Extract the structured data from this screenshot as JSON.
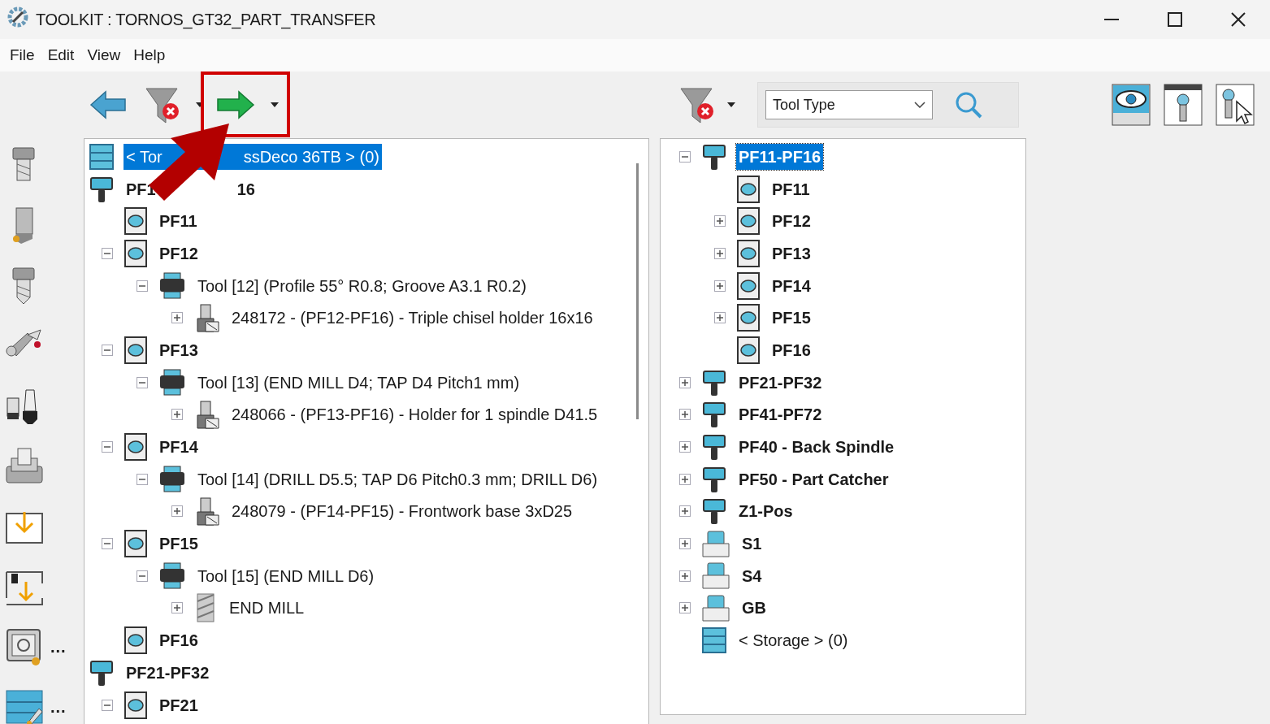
{
  "window": {
    "title": "TOOLKIT : TORNOS_GT32_PART_TRANSFER"
  },
  "menu": [
    "File",
    "Edit",
    "View",
    "Help"
  ],
  "search": {
    "value": "Tool Type"
  },
  "side_tools": [
    {
      "kind": "screw"
    },
    {
      "kind": "insert"
    },
    {
      "kind": "drill"
    },
    {
      "kind": "clamp"
    },
    {
      "kind": "collet"
    },
    {
      "kind": "machine"
    },
    {
      "kind": "import"
    },
    {
      "kind": "tool-import"
    },
    {
      "kind": "safe",
      "more": "..."
    },
    {
      "kind": "storage-edit",
      "more": "..."
    }
  ],
  "left_tree": [
    {
      "kind": "storage",
      "label_parts": [
        "< Tor",
        "ssDeco 36TB > (0)"
      ],
      "expandable": false,
      "selected": true
    },
    {
      "kind": "group",
      "label_parts": [
        "PF1",
        "16"
      ],
      "expandable": false,
      "selected": false,
      "children": [
        {
          "kind": "station",
          "label": "PF11",
          "expandable": false,
          "selected": false
        },
        {
          "kind": "station",
          "label": "PF12",
          "expandable": true,
          "expanded": true,
          "selected": false,
          "children": [
            {
              "kind": "tool",
              "label": "Tool [12] (Profile 55° R0.8; Groove A3.1 R0.2)",
              "expandable": true,
              "expanded": true,
              "selected": false,
              "children": [
                {
                  "kind": "holder",
                  "label": "248172 - (PF12-PF16) - Triple chisel holder 16x16",
                  "expandable": true,
                  "expanded": false,
                  "selected": false
                }
              ]
            }
          ]
        },
        {
          "kind": "station",
          "label": "PF13",
          "expandable": true,
          "expanded": true,
          "selected": false,
          "children": [
            {
              "kind": "tool",
              "label": "Tool [13] (END MILL D4; TAP D4 Pitch1 mm)",
              "expandable": true,
              "expanded": true,
              "selected": false,
              "children": [
                {
                  "kind": "holder",
                  "label": "248066 - (PF13-PF16) - Holder for 1 spindle D41.5",
                  "expandable": true,
                  "expanded": false,
                  "selected": false
                }
              ]
            }
          ]
        },
        {
          "kind": "station",
          "label": "PF14",
          "expandable": true,
          "expanded": true,
          "selected": false,
          "children": [
            {
              "kind": "tool",
              "label": "Tool [14] (DRILL D5.5; TAP D6 Pitch0.3 mm; DRILL D6)",
              "expandable": true,
              "expanded": true,
              "selected": false,
              "children": [
                {
                  "kind": "holder",
                  "label": "248079 - (PF14-PF15) - Frontwork base 3xD25",
                  "expandable": true,
                  "expanded": false,
                  "selected": false
                }
              ]
            }
          ]
        },
        {
          "kind": "station",
          "label": "PF15",
          "expandable": true,
          "expanded": true,
          "selected": false,
          "children": [
            {
              "kind": "tool",
              "label": "Tool [15] (END MILL D6)",
              "expandable": true,
              "expanded": true,
              "selected": false,
              "children": [
                {
                  "kind": "endmill",
                  "label": "END MILL",
                  "expandable": true,
                  "expanded": false,
                  "selected": false
                }
              ]
            }
          ]
        },
        {
          "kind": "station",
          "label": "PF16",
          "expandable": false,
          "selected": false
        }
      ]
    },
    {
      "kind": "group",
      "label": "PF21-PF32",
      "expandable": false,
      "selected": false,
      "children": [
        {
          "kind": "station",
          "label": "PF21",
          "expandable": true,
          "expanded": true,
          "selected": false
        }
      ]
    }
  ],
  "right_tree": [
    {
      "kind": "group",
      "label": "PF11-PF16",
      "expandable": true,
      "expanded": true,
      "selected": true,
      "children": [
        {
          "kind": "station",
          "label": "PF11",
          "expandable": false,
          "selected": false
        },
        {
          "kind": "station",
          "label": "PF12",
          "expandable": true,
          "expanded": false,
          "selected": false
        },
        {
          "kind": "station",
          "label": "PF13",
          "expandable": true,
          "expanded": false,
          "selected": false
        },
        {
          "kind": "station",
          "label": "PF14",
          "expandable": true,
          "expanded": false,
          "selected": false
        },
        {
          "kind": "station",
          "label": "PF15",
          "expandable": true,
          "expanded": false,
          "selected": false
        },
        {
          "kind": "station",
          "label": "PF16",
          "expandable": false,
          "selected": false
        }
      ]
    },
    {
      "kind": "group",
      "label": "PF21-PF32",
      "expandable": true,
      "expanded": false,
      "selected": false
    },
    {
      "kind": "group",
      "label": "PF41-PF72",
      "expandable": true,
      "expanded": false,
      "selected": false
    },
    {
      "kind": "group",
      "label": "PF40 - Back Spindle",
      "expandable": true,
      "expanded": false,
      "selected": false
    },
    {
      "kind": "group",
      "label": "PF50 - Part Catcher",
      "expandable": true,
      "expanded": false,
      "selected": false
    },
    {
      "kind": "group",
      "label": "Z1-Pos",
      "expandable": true,
      "expanded": false,
      "selected": false
    },
    {
      "kind": "stand",
      "label": "S1",
      "expandable": true,
      "expanded": false,
      "selected": false
    },
    {
      "kind": "stand",
      "label": "S4",
      "expandable": true,
      "expanded": false,
      "selected": false
    },
    {
      "kind": "stand",
      "label": "GB",
      "expandable": true,
      "expanded": false,
      "selected": false
    },
    {
      "kind": "storage",
      "label": "< Storage > (0)",
      "expandable": false,
      "selected": false
    }
  ]
}
